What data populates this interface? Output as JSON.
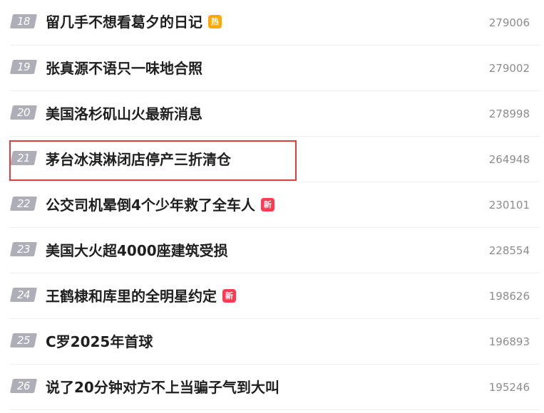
{
  "items": [
    {
      "rank": "18",
      "title": "留几手不想看葛夕的日记",
      "badge": "热",
      "count": "279006"
    },
    {
      "rank": "19",
      "title": "张真源不语只一味地合照",
      "badge": "",
      "count": "279002"
    },
    {
      "rank": "20",
      "title": "美国洛杉矶山火最新消息",
      "badge": "",
      "count": "278998"
    },
    {
      "rank": "21",
      "title": "茅台冰淇淋闭店停产三折清仓",
      "badge": "",
      "count": "264948"
    },
    {
      "rank": "22",
      "title": "公交司机晕倒4个少年救了全车人",
      "badge": "新",
      "count": "230101"
    },
    {
      "rank": "23",
      "title": "美国大火超4000座建筑受损",
      "badge": "",
      "count": "228554"
    },
    {
      "rank": "24",
      "title": "王鹤棣和库里的全明星约定",
      "badge": "新",
      "count": "198626"
    },
    {
      "rank": "25",
      "title": "C罗2025年首球",
      "badge": "",
      "count": "196893"
    },
    {
      "rank": "26",
      "title": "说了20分钟对方不上当骗子气到大叫",
      "badge": "",
      "count": "195246"
    }
  ],
  "colors": {
    "rank_bg": "#aeaeb8",
    "hot_badge": "#ffa800",
    "new_badge": "#ff3b52",
    "highlight_border": "#e23b3b"
  }
}
